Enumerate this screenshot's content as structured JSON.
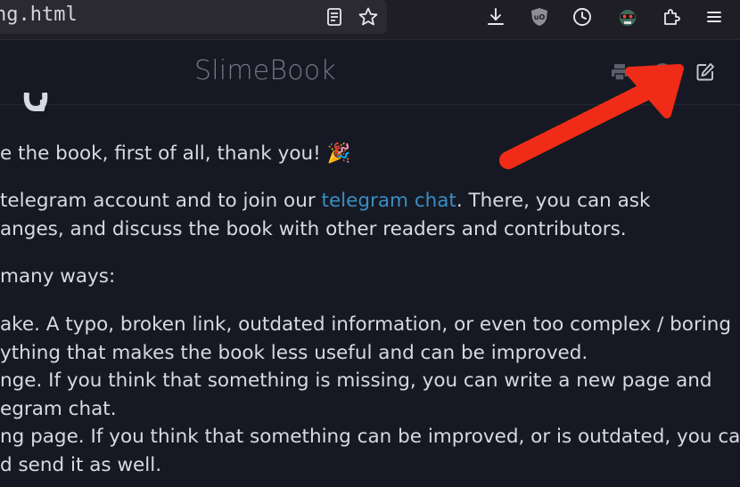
{
  "browser": {
    "url_fragment": "ng.html",
    "icons": [
      "reader-view-icon",
      "bookmark-star-icon",
      "download-icon",
      "ublock-icon",
      "history-clock-icon",
      "extension-avatar-icon",
      "extensions-puzzle-icon",
      "menu-hamburger-icon"
    ]
  },
  "header": {
    "title": "SlimeBook",
    "icons": [
      "print-icon",
      "github-icon",
      "edit-icon"
    ]
  },
  "content": {
    "line1": "e the book, first of all, thank you! 🎉",
    "line2_pre": " telegram account and to join our ",
    "line2_link": "telegram chat",
    "line2_post": ". There, you can ask",
    "line3": "anges, and discuss the book with other readers and contributors.",
    "line4": "many ways:",
    "line5": "ake. A typo, broken link, outdated information, or even too complex / boring",
    "line6": "ything that makes the book less useful and can be improved.",
    "line7": "nge. If you think that something is missing, you can write a new page and",
    "line8": "egram chat.",
    "line9": "ng page. If you think that something can be improved, or is outdated, you can",
    "line10": "d send it as well."
  },
  "colors": {
    "background": "#161923",
    "link": "#3a8ec4",
    "annotation_arrow": "#f02b17"
  }
}
